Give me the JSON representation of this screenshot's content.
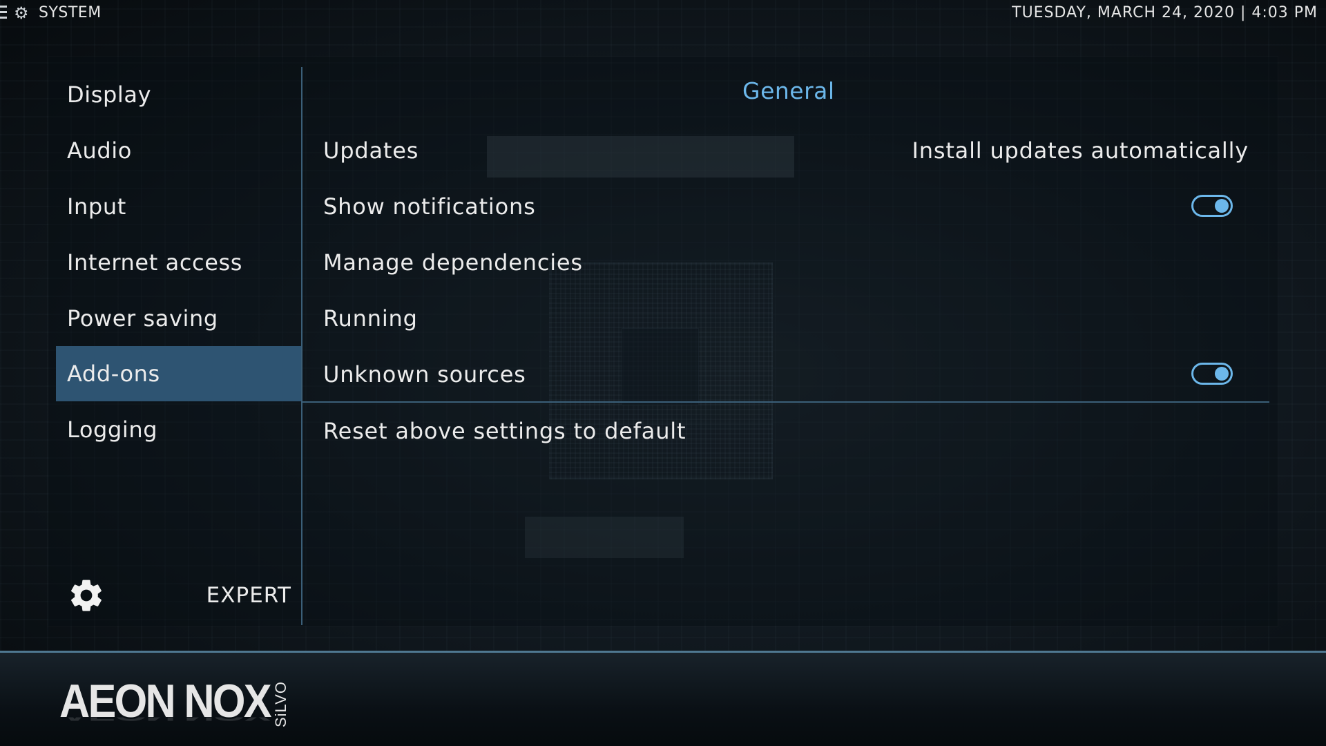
{
  "topbar": {
    "title": "SYSTEM",
    "datetime": "TUESDAY, MARCH 24, 2020 | 4:03 PM"
  },
  "sidebar": {
    "items": [
      {
        "label": "Display"
      },
      {
        "label": "Audio"
      },
      {
        "label": "Input"
      },
      {
        "label": "Internet access"
      },
      {
        "label": "Power saving"
      },
      {
        "label": "Add-ons",
        "active": true
      },
      {
        "label": "Logging"
      }
    ],
    "level_label": "EXPERT"
  },
  "content": {
    "section_title": "General",
    "settings": [
      {
        "label": "Updates",
        "value": "Install updates automatically"
      },
      {
        "label": "Show notifications",
        "toggle": true
      },
      {
        "label": "Manage dependencies"
      },
      {
        "label": "Running"
      },
      {
        "label": "Unknown sources",
        "toggle": true
      },
      {
        "label": "Reset above settings to default"
      }
    ]
  },
  "footer": {
    "logo_main": "AEON NOX",
    "logo_sub": "SiLVO"
  },
  "colors": {
    "accent": "#6cb7ea",
    "selection": "#2e5472",
    "divider": "#3b5f78"
  },
  "icons": {
    "menu": "hamburger-icon",
    "system": "gears-icon",
    "settings_level": "gear-icon"
  }
}
